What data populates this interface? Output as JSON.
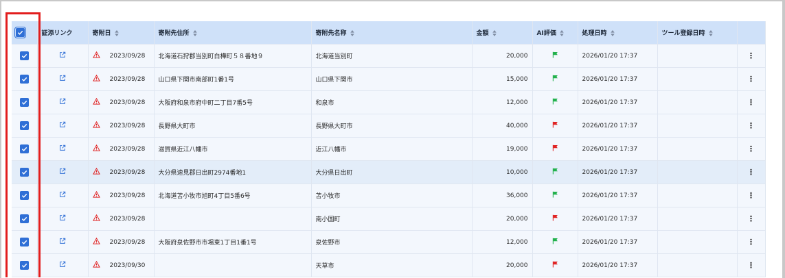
{
  "colors": {
    "header_bg": "#cfe1f9",
    "row_bg": "#f3f7fd",
    "row_highlight_bg": "#e3edf9",
    "checkbox": "#2f6fd6",
    "flag_green": "#22b14c",
    "flag_red": "#e02424",
    "warn_red": "#e02424",
    "link_blue": "#2f6fd6",
    "highlight_box": "#e21d1d"
  },
  "table": {
    "headers": {
      "link": "証添リンク",
      "donation_date": "寄附日",
      "address": "寄附先住所",
      "name": "寄附先名称",
      "amount": "金額",
      "ai_eval": "AI評価",
      "processed_at": "処理日時",
      "registered_at": "ツール登録日時"
    },
    "rows": [
      {
        "date": "2023/09/28",
        "address": "北海道石狩郡当別町白樺町５８番地９",
        "name": "北海道当別町",
        "amount": "20,000",
        "flag": "green",
        "processed": "2026/01/20 17:37",
        "registered": ""
      },
      {
        "date": "2023/09/28",
        "address": "山口県下関市南部町1番1号",
        "name": "山口県下関市",
        "amount": "15,000",
        "flag": "green",
        "processed": "2026/01/20 17:37",
        "registered": ""
      },
      {
        "date": "2023/09/28",
        "address": "大阪府和泉市府中町二丁目7番5号",
        "name": "和泉市",
        "amount": "12,000",
        "flag": "green",
        "processed": "2026/01/20 17:37",
        "registered": ""
      },
      {
        "date": "2023/09/28",
        "address": "長野県大町市",
        "name": "長野県大町市",
        "amount": "40,000",
        "flag": "red",
        "processed": "2026/01/20 17:37",
        "registered": ""
      },
      {
        "date": "2023/09/28",
        "address": "滋賀県近江八幡市",
        "name": "近江八幡市",
        "amount": "19,000",
        "flag": "red",
        "processed": "2026/01/20 17:37",
        "registered": ""
      },
      {
        "date": "2023/09/28",
        "address": "大分県速見郡日出町2974番地1",
        "name": "大分県日出町",
        "amount": "10,000",
        "flag": "green",
        "processed": "2026/01/20 17:37",
        "registered": "",
        "highlight": true
      },
      {
        "date": "2023/09/28",
        "address": "北海道苫小牧市旭町4丁目5番6号",
        "name": "苫小牧市",
        "amount": "36,000",
        "flag": "green",
        "processed": "2026/01/20 17:37",
        "registered": ""
      },
      {
        "date": "2023/09/28",
        "address": "",
        "name": "南小国町",
        "amount": "20,000",
        "flag": "red",
        "processed": "2026/01/20 17:37",
        "registered": ""
      },
      {
        "date": "2023/09/28",
        "address": "大阪府泉佐野市市場東1丁目1番1号",
        "name": "泉佐野市",
        "amount": "12,000",
        "flag": "green",
        "processed": "2026/01/20 17:37",
        "registered": ""
      },
      {
        "date": "2023/09/30",
        "address": "",
        "name": "天草市",
        "amount": "20,000",
        "flag": "red",
        "processed": "2026/01/20 17:37",
        "registered": ""
      }
    ]
  }
}
